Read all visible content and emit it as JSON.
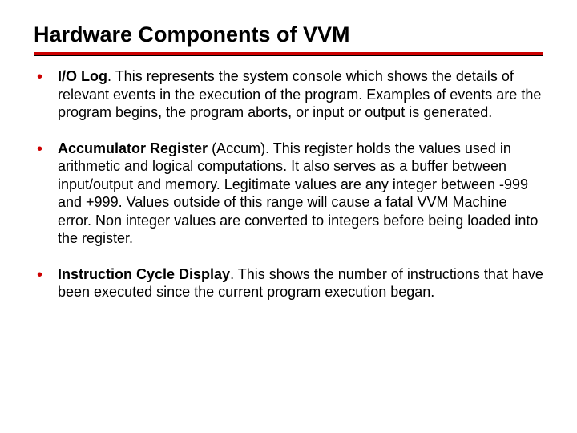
{
  "title": "Hardware Components of VVM",
  "items": [
    {
      "term": "I/O Log",
      "suffix": ". ",
      "body": "This represents the system console which shows the details of relevant events in the execution of the program. Examples of events are the program begins, the program aborts, or input or output is generated."
    },
    {
      "term": "Accumulator Register",
      "suffix": " (Accum). ",
      "body": "This register holds the values used in arithmetic and logical computations. It also serves as a buffer between input/output and memory. Legitimate values are any integer between -999 and +999. Values outside of this range will cause a fatal VVM Machine error. Non integer values are converted to integers before being loaded into the register."
    },
    {
      "term": "Instruction Cycle Display",
      "suffix": ". ",
      "body": "This shows the number of instructions that have been executed since the current program execution began."
    }
  ]
}
